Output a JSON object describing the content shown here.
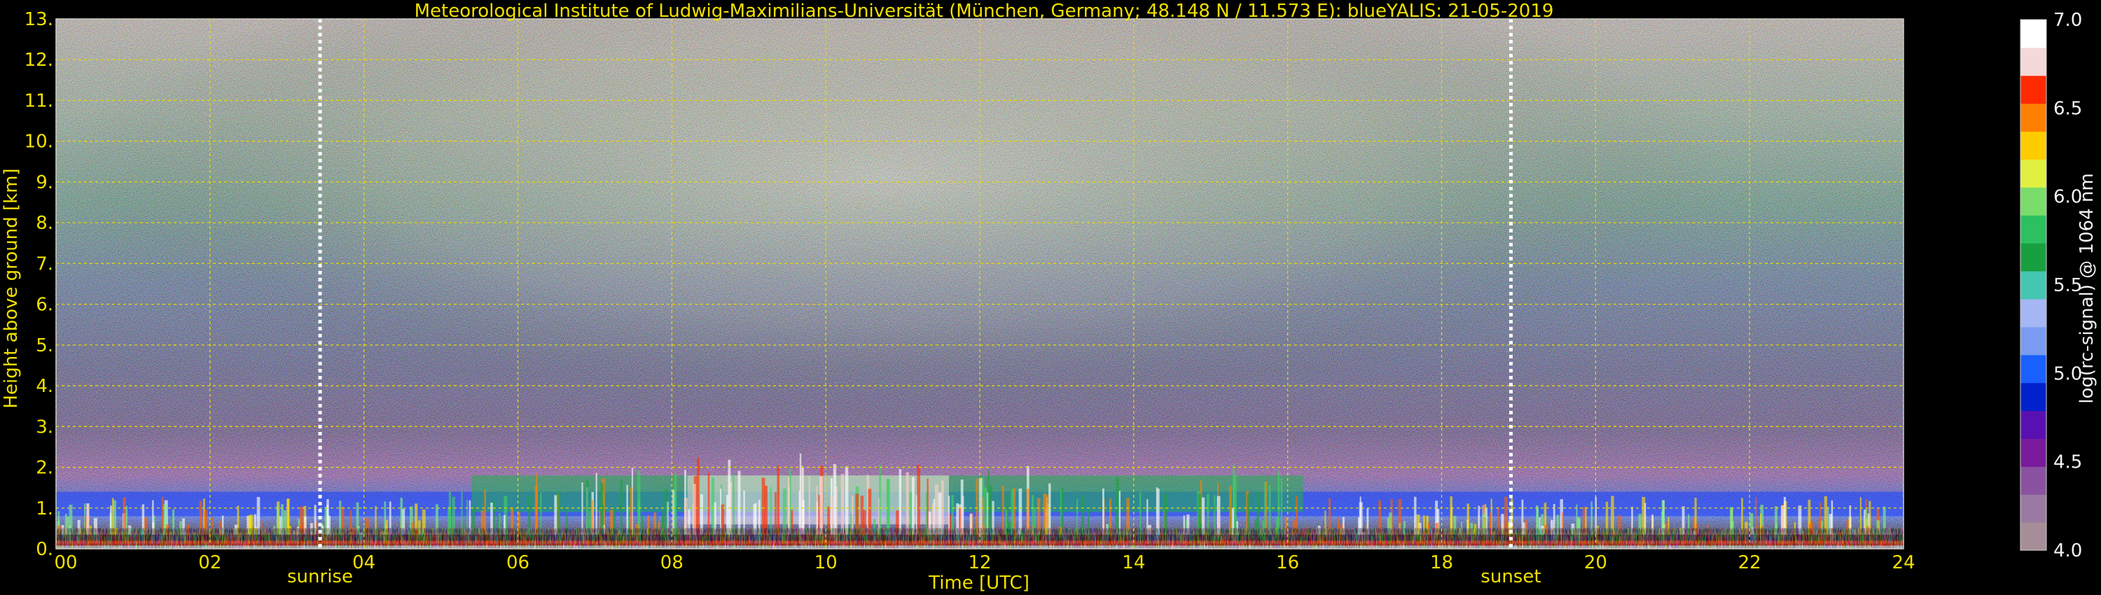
{
  "chart_data": {
    "type": "heatmap",
    "title": "Meteorological Institute of Ludwig-Maximilians-Universität (München, Germany; 48.148 N / 11.573 E):    blueYALIS: 21-05-2019",
    "xlabel": "Time [UTC]",
    "ylabel": "Height above ground [km]",
    "xlim": [
      0,
      24
    ],
    "ylim": [
      0,
      13
    ],
    "x_ticks": [
      "00",
      "02",
      "04",
      "06",
      "08",
      "10",
      "12",
      "14",
      "16",
      "18",
      "20",
      "22",
      "24"
    ],
    "y_ticks": [
      "0.",
      "1.",
      "2.",
      "3.",
      "4.",
      "5.",
      "6.",
      "7.",
      "8.",
      "9.",
      "10.",
      "11.",
      "12.",
      "13."
    ],
    "grid": true,
    "annotations": [
      {
        "label": "sunrise",
        "x": 3.43
      },
      {
        "label": "sunset",
        "x": 18.9
      }
    ],
    "colorbar": {
      "label": "log(rc-signal) @ 1064 nm",
      "range": [
        4.0,
        7.0
      ],
      "ticks": [
        "4.0",
        "4.5",
        "5.0",
        "5.5",
        "6.0",
        "6.5",
        "7.0"
      ],
      "colors": [
        "#a78d97",
        "#9a7aa2",
        "#8a52a0",
        "#7a1a9c",
        "#5a10b0",
        "#0022cc",
        "#1a60ff",
        "#7a9cf0",
        "#a4b6f4",
        "#44c6b0",
        "#18a040",
        "#2cc060",
        "#7adc6a",
        "#e0f040",
        "#ffcc00",
        "#ff8000",
        "#ff2a00",
        "#f5d8d8",
        "#ffffff"
      ]
    }
  }
}
